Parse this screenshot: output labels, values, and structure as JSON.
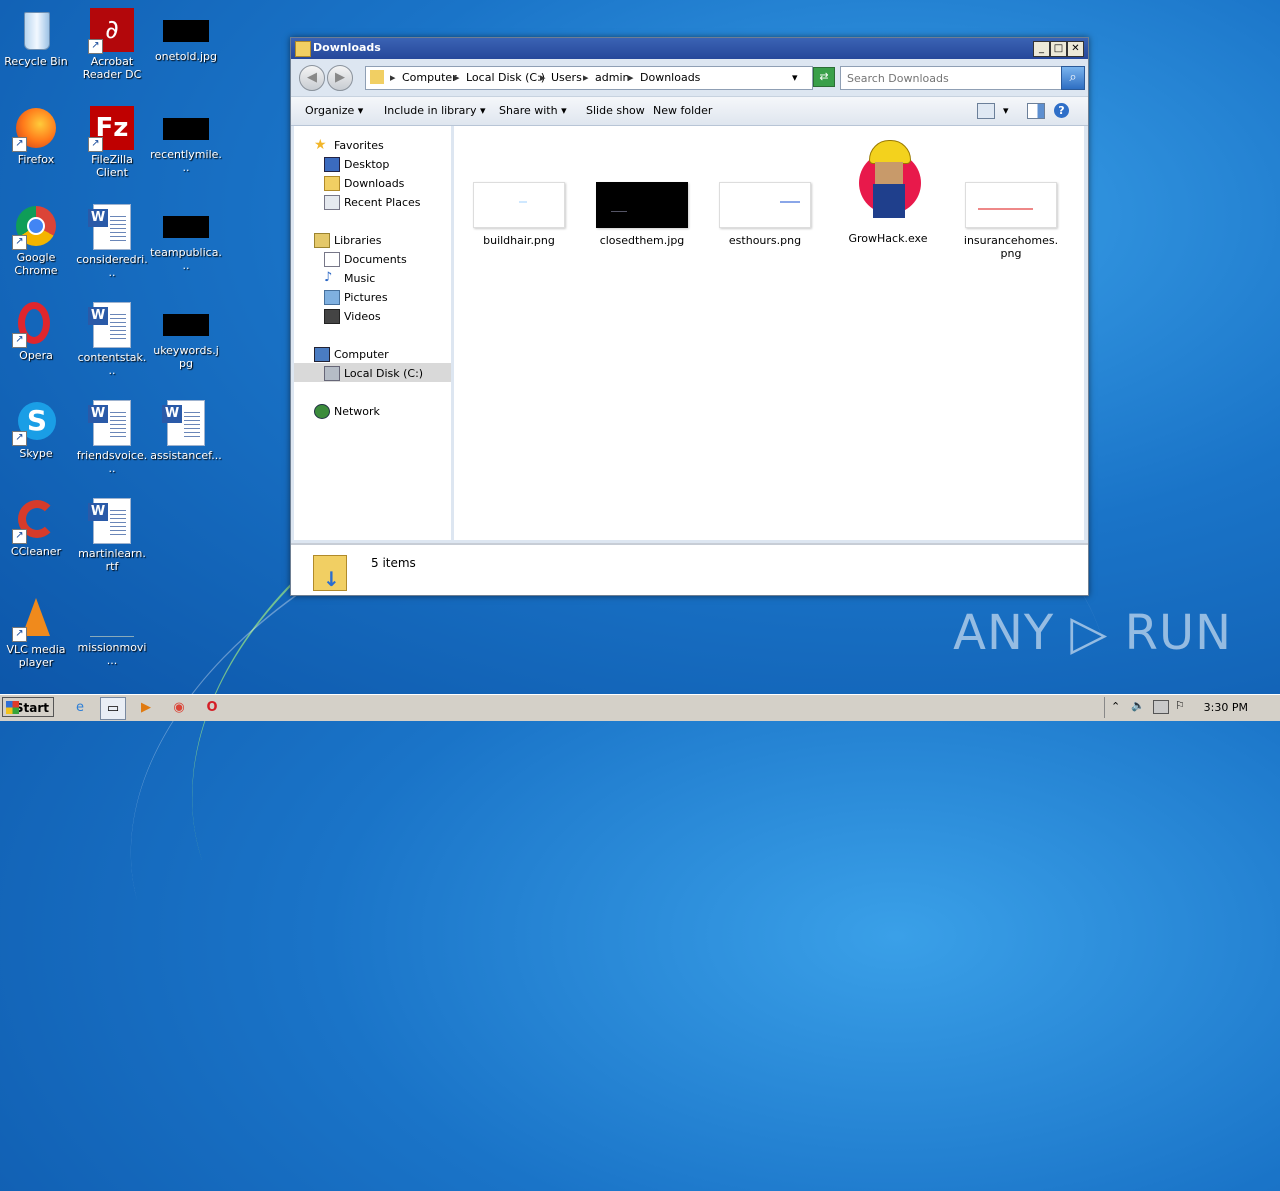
{
  "desktop": {
    "icons": [
      {
        "label": "Recycle Bin"
      },
      {
        "label": "Acrobat Reader DC"
      },
      {
        "label": "onetold.jpg"
      },
      {
        "label": "Firefox"
      },
      {
        "label": "FileZilla Client"
      },
      {
        "label": "recentlymile..."
      },
      {
        "label": "Google Chrome"
      },
      {
        "label": "consideredri..."
      },
      {
        "label": "teampublica..."
      },
      {
        "label": "Opera"
      },
      {
        "label": "contentstak..."
      },
      {
        "label": "ukeywords.jpg"
      },
      {
        "label": "Skype"
      },
      {
        "label": "friendsvoice..."
      },
      {
        "label": "assistancef..."
      },
      {
        "label": "CCleaner"
      },
      {
        "label": "martinlearn.rtf"
      },
      {
        "label": "VLC media player"
      },
      {
        "label": "missionmovi..."
      }
    ]
  },
  "window": {
    "title": "Downloads",
    "controls": {
      "minimize": "_",
      "maximize": "□",
      "close": "✕"
    },
    "breadcrumbs": [
      "Computer",
      "Local Disk (C:)",
      "Users",
      "admin",
      "Downloads"
    ],
    "search_placeholder": "Search Downloads",
    "toolbar": {
      "organize": "Organize",
      "include": "Include in library",
      "share": "Share with",
      "slideshow": "Slide show",
      "newfolder": "New folder"
    },
    "nav": {
      "favorites": "Favorites",
      "desktop": "Desktop",
      "downloads": "Downloads",
      "recent": "Recent Places",
      "libraries": "Libraries",
      "documents": "Documents",
      "music": "Music",
      "pictures": "Pictures",
      "videos": "Videos",
      "computer": "Computer",
      "localdisk": "Local Disk (C:)",
      "network": "Network"
    },
    "files": [
      {
        "name": "buildhair.png"
      },
      {
        "name": "closedthem.jpg"
      },
      {
        "name": "esthours.png"
      },
      {
        "name": "GrowHack.exe"
      },
      {
        "name": "insurancehomes.png"
      }
    ],
    "item_count": "5 items"
  },
  "taskbar": {
    "start": "Start",
    "clock": "3:30 PM"
  },
  "watermark": "ANY ▷ RUN",
  "colors": {
    "title_bar": "#2b4fa3",
    "desktop": "#1a74c8",
    "selection": "#d9d9d9"
  }
}
